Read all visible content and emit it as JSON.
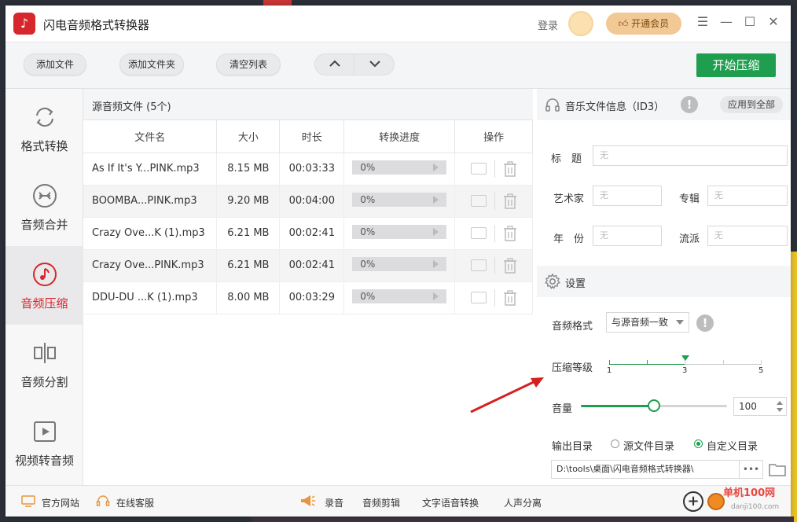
{
  "app": {
    "title": "闪电音频格式转换器",
    "logo_icon": "music-note-icon"
  },
  "titlebar": {
    "login": "登录",
    "vip": "开通会员",
    "menu": "☰",
    "minimize": "—",
    "maximize": "☐",
    "close": "✕"
  },
  "toolbar": {
    "add_file": "添加文件",
    "add_folder": "添加文件夹",
    "clear_list": "清空列表",
    "up": "︿",
    "down": "﹀",
    "start": "开始压缩"
  },
  "sidebar": {
    "items": [
      {
        "label": "格式转换",
        "icon": "refresh-icon",
        "active": false
      },
      {
        "label": "音频合并",
        "icon": "merge-icon",
        "active": false
      },
      {
        "label": "音频压缩",
        "icon": "music-note-icon",
        "active": true
      },
      {
        "label": "音频分割",
        "icon": "split-icon",
        "active": false
      },
      {
        "label": "视频转音频",
        "icon": "video-icon",
        "active": false
      }
    ]
  },
  "filelist": {
    "title": "源音频文件 (5个)",
    "columns": [
      "文件名",
      "大小",
      "时长",
      "转换进度",
      "操作"
    ],
    "rows": [
      {
        "name": "As If It's Y...PINK.mp3",
        "size": "8.15 MB",
        "duration": "00:03:33",
        "progress": "0%"
      },
      {
        "name": "BOOMBA...PINK.mp3",
        "size": "9.20 MB",
        "duration": "00:04:00",
        "progress": "0%"
      },
      {
        "name": "Crazy Ove...K (1).mp3",
        "size": "6.21 MB",
        "duration": "00:02:41",
        "progress": "0%"
      },
      {
        "name": "Crazy Ove...PINK.mp3",
        "size": "6.21 MB",
        "duration": "00:02:41",
        "progress": "0%"
      },
      {
        "name": "DDU-DU ...K (1).mp3",
        "size": "8.00 MB",
        "duration": "00:03:29",
        "progress": "0%"
      }
    ]
  },
  "id3": {
    "title": "音乐文件信息（ID3）",
    "apply_all": "应用到全部",
    "fields": {
      "title_label": "标　题",
      "artist_label": "艺术家",
      "album_label": "专辑",
      "year_label": "年　份",
      "genre_label": "流派",
      "placeholder": "无"
    }
  },
  "settings": {
    "title": "设置",
    "format_label": "音频格式",
    "format_value": "与源音频一致",
    "level_label": "压缩等级",
    "level_ticks": [
      "1",
      "3",
      "5"
    ],
    "level_value": 3,
    "volume_label": "音量",
    "volume_value": "100",
    "volume_fraction": 0.5,
    "output_label": "输出目录",
    "radio_source": "源文件目录",
    "radio_custom": "自定义目录",
    "output_path": "D:\\tools\\桌面\\闪电音频格式转换器\\",
    "dots": "•••"
  },
  "footer": {
    "website": "官方网站",
    "support": "在线客服",
    "record": "录音",
    "audio_edit": "音频剪辑",
    "tts": "文字语音转换",
    "vocal_sep": "人声分离"
  },
  "watermark": {
    "line1": "单机100网",
    "line2": "danji100.com"
  },
  "colors": {
    "accent_green": "#1e9e4e",
    "accent_red": "#d6272c",
    "vip_gold": "#f2c894"
  }
}
